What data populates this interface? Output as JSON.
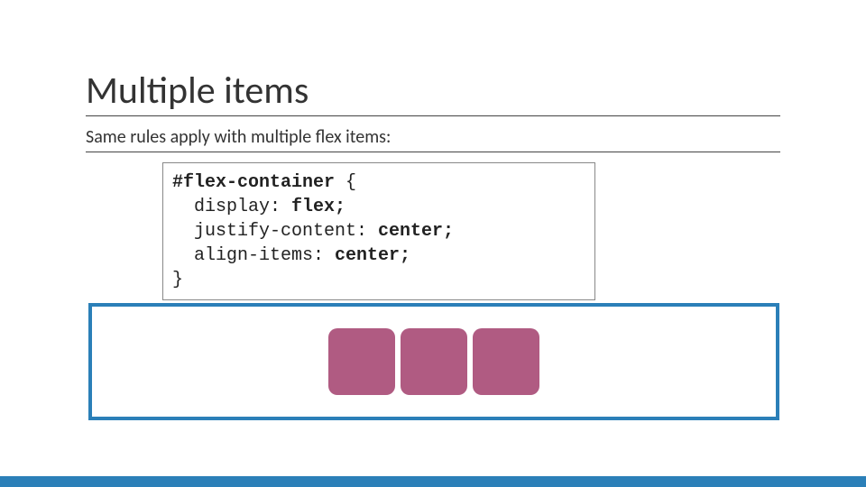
{
  "title": "Multiple items",
  "subtitle": "Same rules apply with multiple flex items:",
  "code": {
    "l1a": "#flex-container",
    "l1b": " {",
    "l2a": "display: ",
    "l2b": "flex;",
    "l3a": "justify-content: ",
    "l3b": "center;",
    "l4a": "align-items: ",
    "l4b": "center;",
    "l5": "}"
  },
  "colors": {
    "accent": "#2b7fb8",
    "item": "#b05b82"
  }
}
